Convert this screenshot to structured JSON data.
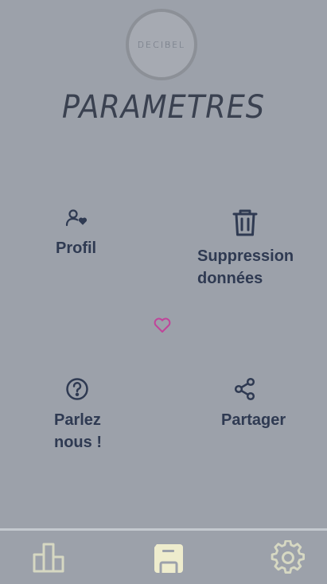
{
  "header": {
    "logo_text": "DECIBEL",
    "title": "PARAMETRES"
  },
  "menu": {
    "profil": {
      "label": "Profil",
      "icon": "user-heart-icon"
    },
    "suppression": {
      "label": "Suppression\ndonnées",
      "icon": "trash-icon"
    },
    "parlez": {
      "label": "Parlez\nnous !",
      "icon": "question-circle-icon"
    },
    "partager": {
      "label": "Partager",
      "icon": "share-icon"
    }
  },
  "decoration": {
    "icon": "heart-icon",
    "color": "#c0449a"
  },
  "tabbar": {
    "tabs": [
      {
        "name": "stats",
        "icon": "bar-chart-icon",
        "active": false
      },
      {
        "name": "save",
        "icon": "floppy-disk-icon",
        "active": true
      },
      {
        "name": "settings",
        "icon": "gear-icon",
        "active": false
      }
    ],
    "icon_color": "#d6d8c2",
    "active_color": "#eeeccd"
  },
  "colors": {
    "background": "#9ca1aa",
    "text": "#2f3a52"
  }
}
